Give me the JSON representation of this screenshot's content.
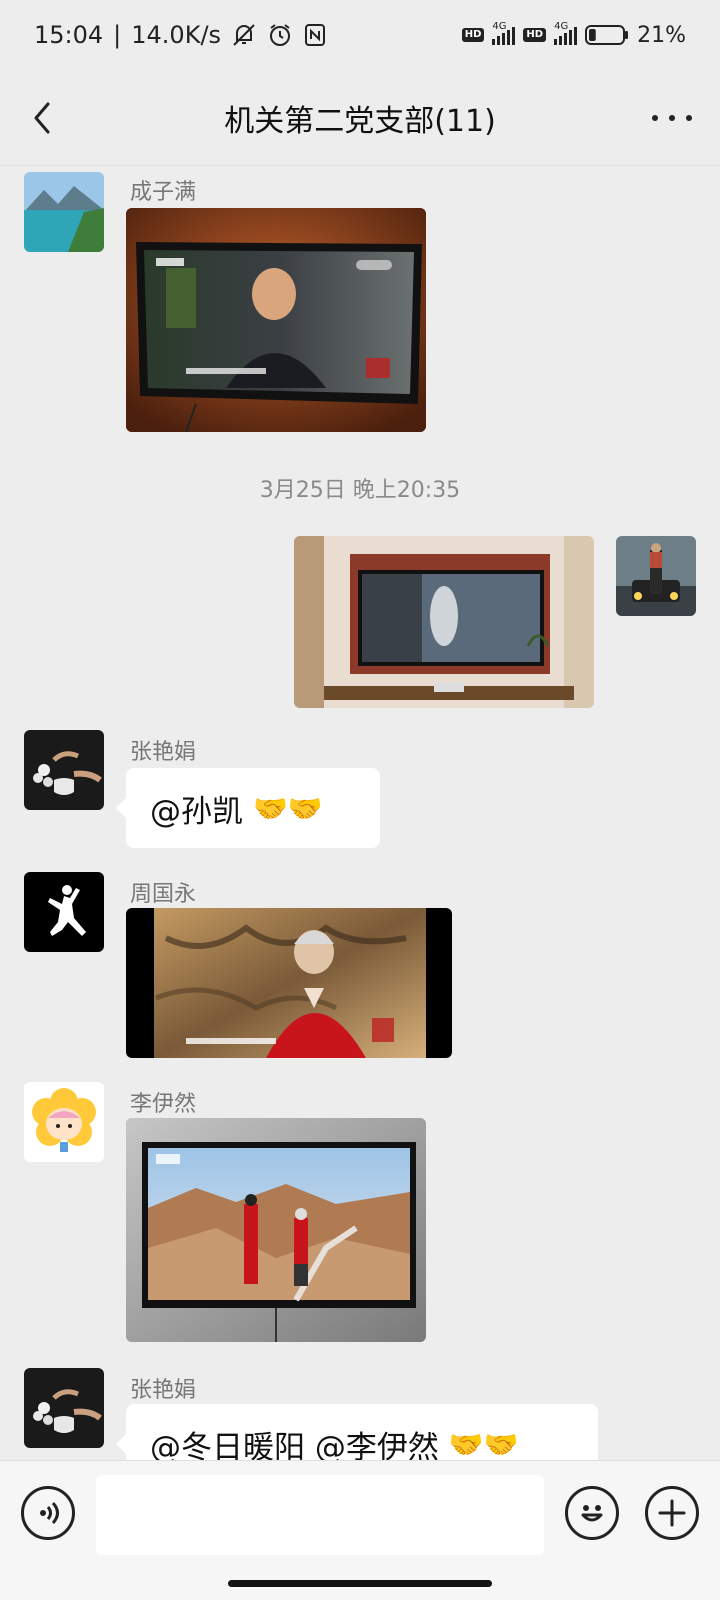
{
  "status_bar": {
    "time": "15:04",
    "network_speed": "14.0K/s",
    "net_type_1": "4G",
    "net_type_2": "4G",
    "hd_label": "HD",
    "battery_percent": "21%",
    "battery_level": 0.21
  },
  "header": {
    "title": "机关第二党支部(11)"
  },
  "messages": [
    {
      "sender": "成子满",
      "type": "image"
    },
    {
      "type": "timestamp",
      "text": "3月25日 晚上20:35"
    },
    {
      "sender": "",
      "type": "image",
      "outgoing": true
    },
    {
      "sender": "张艳娟",
      "type": "text",
      "text": "@孙凯",
      "emoji": "🤝🤝"
    },
    {
      "sender": "周国永",
      "type": "image"
    },
    {
      "sender": "李伊然",
      "type": "image"
    },
    {
      "sender": "张艳娟",
      "type": "text",
      "text": "@冬日暖阳  @李伊然",
      "emoji": "🤝🤝"
    }
  ],
  "icons": {
    "voice": "voice-icon",
    "emoji": "emoji-icon",
    "add": "plus-icon",
    "back": "back-icon",
    "more": "more-icon"
  }
}
